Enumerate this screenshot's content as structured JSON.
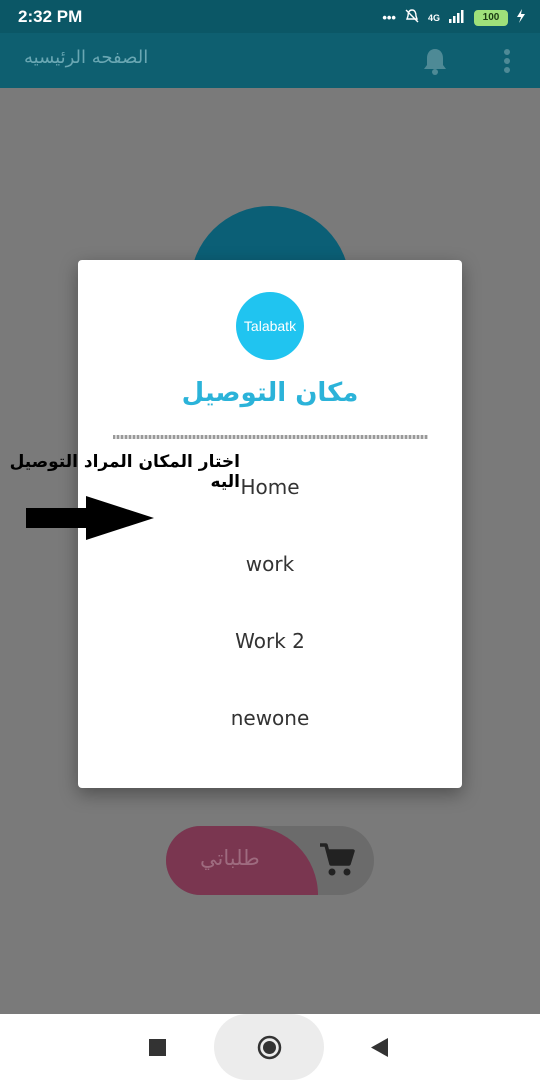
{
  "status_bar": {
    "time": "2:32 PM",
    "icons": [
      "more-dots-icon",
      "mute-icon",
      "network-4g-icon",
      "signal-icon",
      "battery-icon",
      "charging-icon"
    ],
    "network": "4G",
    "battery": "100"
  },
  "app_bar": {
    "title": "الصفحه الرئيسيه",
    "icons": [
      "bell-icon",
      "more-vert-icon"
    ]
  },
  "dialog": {
    "logo_text": "Talabatk",
    "title": "مكان التوصيل",
    "options": [
      "Home",
      "work",
      "Work 2",
      "newone"
    ]
  },
  "annotation": {
    "text": "اختار المكان المراد التوصيل اليه",
    "icon": "arrow-right-icon"
  },
  "background": {
    "orders_button_label": "طلباتي",
    "cart_icon": "cart-icon"
  },
  "nav_bar": {
    "icons": [
      "recent-apps-icon",
      "home-icon",
      "back-icon"
    ]
  },
  "colors": {
    "status_bar": "#0b5766",
    "app_bar": "#0e5f70",
    "accent": "#2bb3d9",
    "logo": "#20c4f0",
    "orders_pill": "#7a3650"
  }
}
